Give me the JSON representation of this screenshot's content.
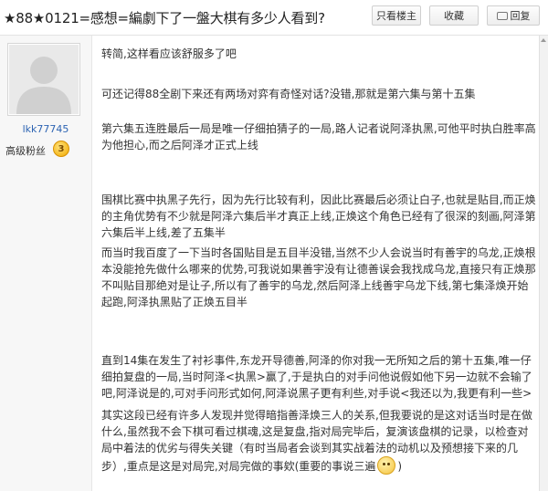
{
  "header": {
    "title": "★88★0121=感想=編劇下了一盤大棋有多少人看到?",
    "buttons": {
      "only_op": "只看楼主",
      "favorite": "收藏",
      "reply": "回复"
    }
  },
  "author": {
    "username": "lkk77745",
    "rank_title": "高级粉丝",
    "level": "3"
  },
  "post": {
    "paragraphs": [
      "转简,这样看应该舒服多了吧",
      "可还记得88全剧下来还有两场对弈有奇怪对话?没错,那就是第六集与第十五集",
      "第六集五连胜最后一局是唯一仔细拍猜子的一局,路人记者说阿泽执黑,可他平时执白胜率高为他担心,而之后阿泽才正式上线",
      "围棋比赛中执黑子先行，因为先行比较有利，因此比赛最后必须让白子,也就是贴目,而正焕的主角优势有不少就是阿泽六集后半才真正上线,正焕这个角色已经有了很深的刻画,阿泽第六集后半上线,差了五集半",
      "而当时我百度了一下当时各国贴目是五目半没错,当然不少人会说当时有善宇的乌龙,正焕根本没能抢先做什么哪来的优势,可我说如果善宇没有让德善误会我找成乌龙,直接只有正焕那不叫贴目那绝对是让子,所以有了善宇的乌龙,然后阿泽上线善宇乌龙下线,第七集泽焕开始起跑,阿泽执黑贴了正焕五目半",
      "直到14集在发生了衬衫事件,东龙开导德善,阿泽的你对我一无所知之后的第十五集,唯一仔细拍复盘的一局,当时阿泽<执黑>赢了,于是执白的对手问他说假如他下另一边就不会输了吧,阿泽说是的,可对手问形式如何,阿泽说黑子更有利些,对手说<我还以为,我更有利一些>",
      "其实这段已经有许多人发现并觉得暗指善泽焕三人的关系,但我要说的是这对话当时是在做什么,虽然我不会下棋可看过棋魂,这是复盘,指对局完毕后，复演该盘棋的记录，以检查对局中着法的优劣与得失关键（有时当局者会谈到其实战着法的动机以及预想接下来的几步）,重点是这是对局完,对局完做的事欸(重要的事说三遍"
    ],
    "trailing": ")"
  },
  "icons": {
    "reply": "reply-icon",
    "level_badge": "level-badge-icon",
    "emoji": "smile-emoji-icon"
  }
}
